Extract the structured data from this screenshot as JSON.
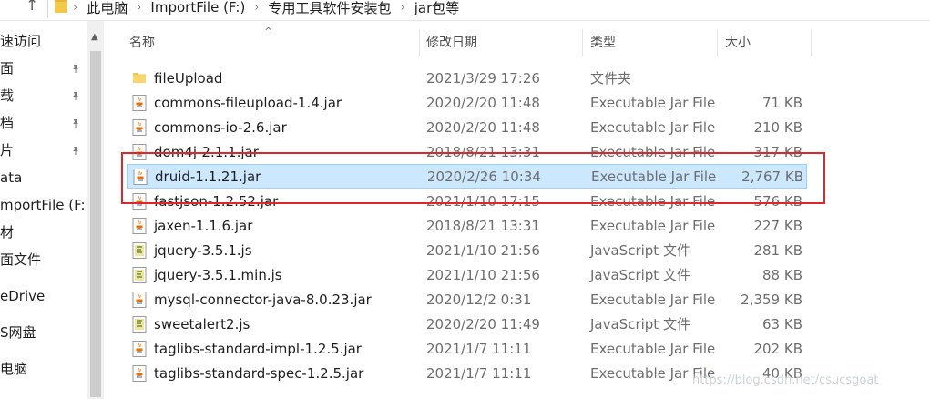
{
  "address_bar": {
    "crumbs": [
      "此电脑",
      "ImportFile (F:)",
      "专用工具软件安装包",
      "jar包等"
    ]
  },
  "nav": {
    "items": [
      {
        "label": "速访问",
        "pinned": false
      },
      {
        "label": "面",
        "pinned": true
      },
      {
        "label": "载",
        "pinned": true
      },
      {
        "label": "档",
        "pinned": true
      },
      {
        "label": "片",
        "pinned": true
      },
      {
        "label": "ata",
        "pinned": false
      },
      {
        "label": "mportFile (F:)",
        "pinned": false
      },
      {
        "label": "材",
        "pinned": false
      },
      {
        "label": "面文件",
        "pinned": false
      },
      {
        "label": "eDrive",
        "pinned": false
      },
      {
        "label": "S网盘",
        "pinned": false
      },
      {
        "label": "电脑",
        "pinned": false
      }
    ]
  },
  "columns": {
    "name": "名称",
    "date": "修改日期",
    "type": "类型",
    "size": "大小"
  },
  "files": [
    {
      "name": "fileUpload",
      "date": "2021/3/29 17:26",
      "type": "文件夹",
      "size": "",
      "icon": "folder-icon"
    },
    {
      "name": "commons-fileupload-1.4.jar",
      "date": "2020/2/20 11:48",
      "type": "Executable Jar File",
      "size": "71 KB",
      "icon": "jar-icon"
    },
    {
      "name": "commons-io-2.6.jar",
      "date": "2020/2/20 11:48",
      "type": "Executable Jar File",
      "size": "210 KB",
      "icon": "jar-icon"
    },
    {
      "name": "dom4j-2.1.1.jar",
      "date": "2018/8/21 13:31",
      "type": "Executable Jar File",
      "size": "317 KB",
      "icon": "jar-icon"
    },
    {
      "name": "druid-1.1.21.jar",
      "date": "2020/2/26 10:34",
      "type": "Executable Jar File",
      "size": "2,767 KB",
      "icon": "jar-icon",
      "selected": true
    },
    {
      "name": "fastjson-1.2.52.jar",
      "date": "2021/1/10 17:15",
      "type": "Executable Jar File",
      "size": "576 KB",
      "icon": "jar-icon"
    },
    {
      "name": "jaxen-1.1.6.jar",
      "date": "2018/8/21 13:31",
      "type": "Executable Jar File",
      "size": "227 KB",
      "icon": "jar-icon"
    },
    {
      "name": "jquery-3.5.1.js",
      "date": "2021/1/10 21:56",
      "type": "JavaScript 文件",
      "size": "281 KB",
      "icon": "js-icon"
    },
    {
      "name": "jquery-3.5.1.min.js",
      "date": "2021/1/10 21:56",
      "type": "JavaScript 文件",
      "size": "88 KB",
      "icon": "js-icon"
    },
    {
      "name": "mysql-connector-java-8.0.23.jar",
      "date": "2020/12/2 0:31",
      "type": "Executable Jar File",
      "size": "2,359 KB",
      "icon": "jar-icon"
    },
    {
      "name": "sweetalert2.js",
      "date": "2020/2/20 11:49",
      "type": "JavaScript 文件",
      "size": "63 KB",
      "icon": "js-icon"
    },
    {
      "name": "taglibs-standard-impl-1.2.5.jar",
      "date": "2021/1/7 11:11",
      "type": "Executable Jar File",
      "size": "202 KB",
      "icon": "jar-icon"
    },
    {
      "name": "taglibs-standard-spec-1.2.5.jar",
      "date": "2021/1/7 11:11",
      "type": "Executable Jar File",
      "size": "40 KB",
      "icon": "jar-icon"
    }
  ],
  "highlight_color": "#e0262b",
  "selection_color": "#cce8ff",
  "watermark": "https://blog.csdn.net/csucsgoat"
}
